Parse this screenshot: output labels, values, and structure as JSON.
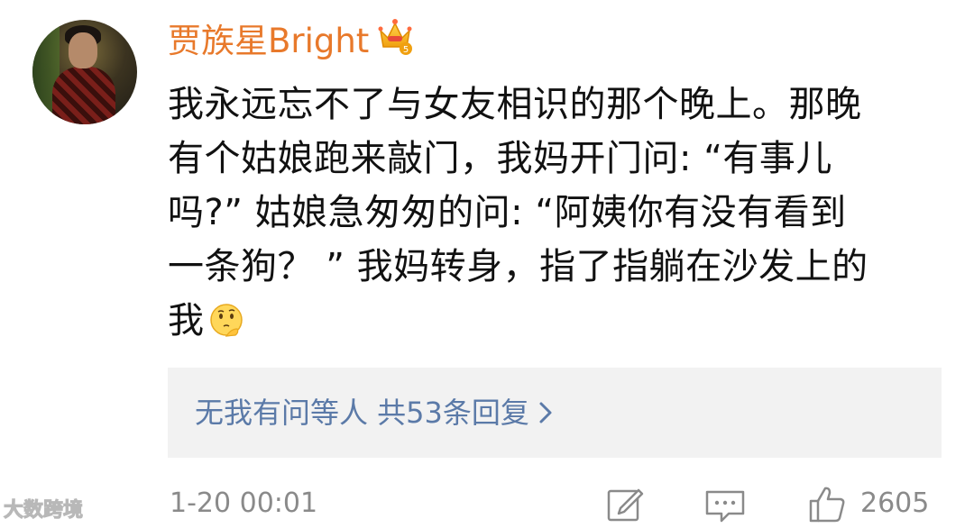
{
  "comment": {
    "username": "贾族星Bright",
    "badge_icon": "crown-icon",
    "content_lines": [
      "我永远忘不了与女友相识的那个晚上。那晚",
      "有个姑娘跑来敲门，我妈开门问: “有事儿",
      "吗?” 姑娘急匆匆的问: “阿姨你有没有看到",
      "一条狗？ ” 我妈转身，指了指躺在沙发上的",
      "我"
    ],
    "emoji_icon": "thinking-face-emoji",
    "replies_summary": "无我有问等人 共53条回复",
    "timestamp": "1-20 00:01",
    "like_count": "2605"
  },
  "watermark": "大数跨境",
  "colors": {
    "username": "#e8792b",
    "link": "#5b7aa8",
    "meta": "#8a8a8a",
    "reply_bg": "#f2f2f2"
  }
}
